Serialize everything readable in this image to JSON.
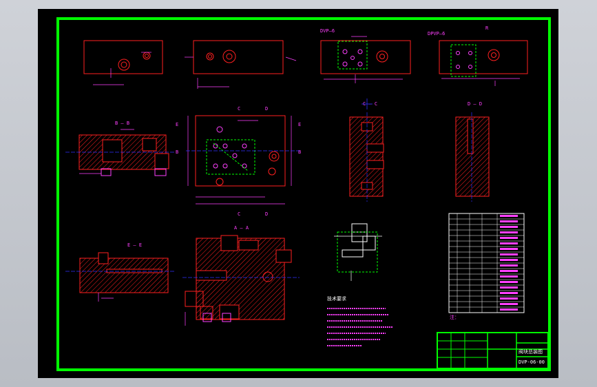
{
  "colors": {
    "frame": "#00ff00",
    "outline": "#ff2020",
    "dimension": "#ff40ff",
    "hatch": "#ff2020",
    "hidden": "#00ff00",
    "centerline": "#3030ff",
    "text": "#ffffff",
    "background": "#000000"
  },
  "views": {
    "bb": "B — B",
    "aa": "A — A",
    "cc": "C — C",
    "dd": "D — D",
    "ee": "E — E"
  },
  "top_labels": {
    "valve_left": "DVP—6",
    "valve_right": "DPVP—6",
    "mark_r": "R"
  },
  "section_marks": {
    "c": "C",
    "d": "D",
    "a": "A",
    "b": "B",
    "e": "E"
  },
  "notes_title": "技术要求",
  "title_block": {
    "drawing_no": "DVP-06-00",
    "title": "阀块总装图"
  },
  "table_caption": "注：",
  "icons": [
    "crosshair-icon"
  ]
}
